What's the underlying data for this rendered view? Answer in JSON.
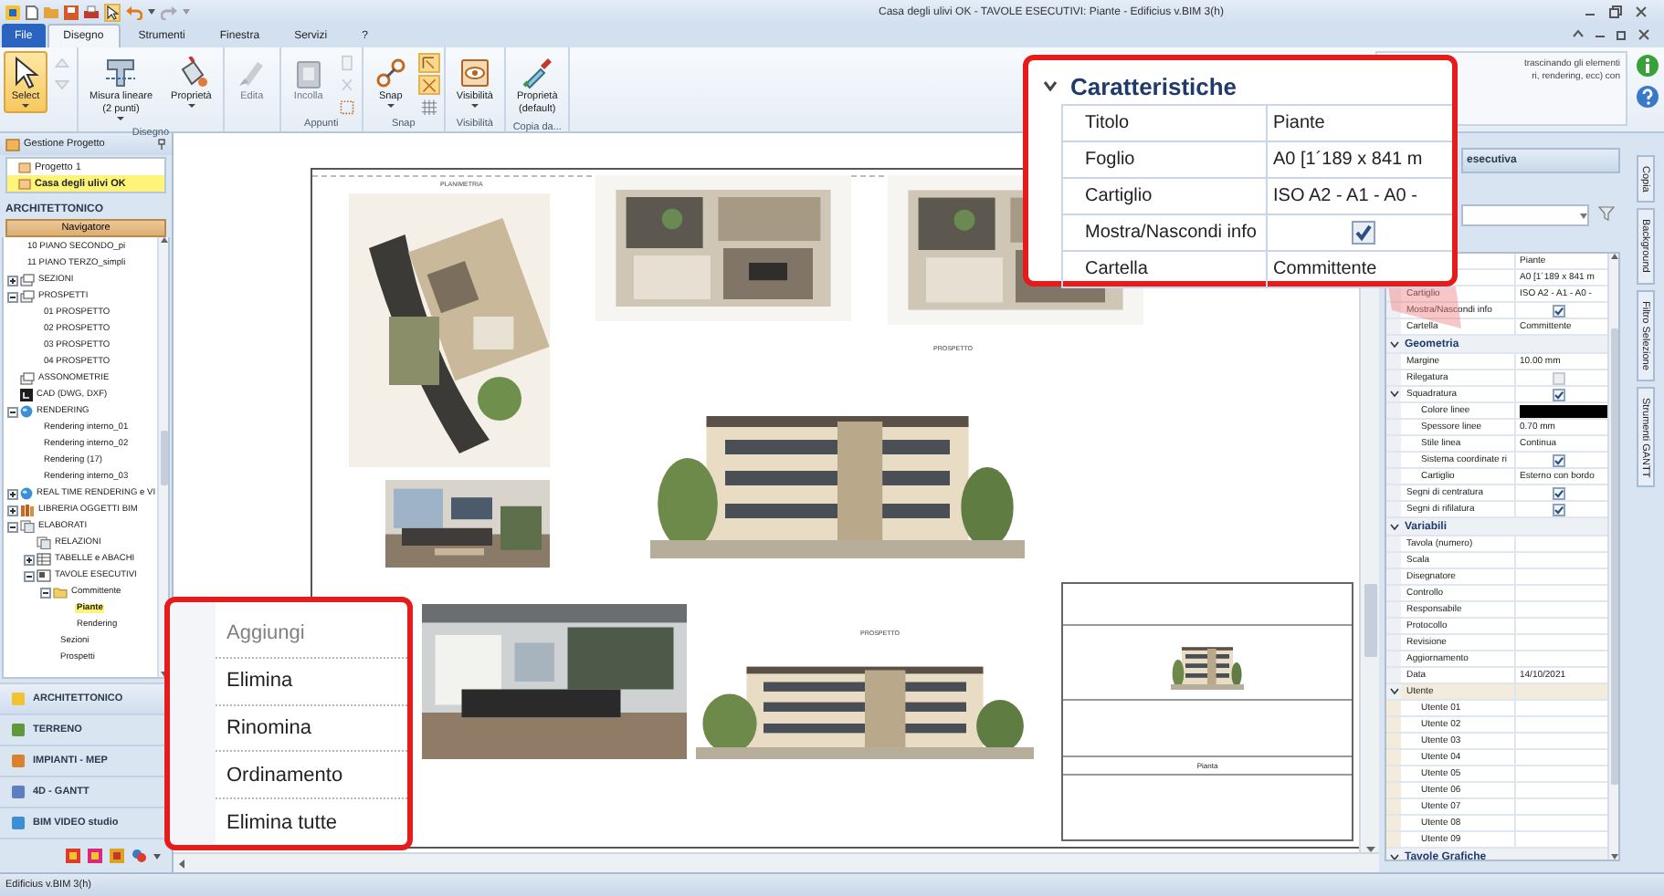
{
  "title_bar": {
    "title": "Casa degli ulivi OK -  TAVOLE ESECUTIVI: Piante - Edificius v.BIM 3(h)"
  },
  "menu_tabs": [
    {
      "label": "File",
      "kind": "file",
      "selected": false
    },
    {
      "label": "Disegno",
      "kind": "tab",
      "selected": true
    },
    {
      "label": "Strumenti",
      "kind": "tab",
      "selected": false
    },
    {
      "label": "Finestra",
      "kind": "tab",
      "selected": false
    },
    {
      "label": "Servizi",
      "kind": "tab",
      "selected": false
    },
    {
      "label": "?",
      "kind": "tab",
      "selected": false
    }
  ],
  "ribbon": {
    "groups": [
      {
        "items": [
          {
            "kind": "large",
            "lines": [
              "Select"
            ],
            "selected": true,
            "disabled": false,
            "dropdown": true
          },
          {
            "kind": "stack",
            "buttons": [
              {
                "selected": false,
                "disabled": true
              },
              {
                "selected": false,
                "disabled": true
              }
            ]
          }
        ]
      },
      {
        "label": "Disegno",
        "items": [
          {
            "kind": "large",
            "lines": [
              "Misura lineare",
              "(2 punti)"
            ],
            "selected": false,
            "disabled": false,
            "dropdown": true
          },
          {
            "kind": "large",
            "lines": [
              "Proprietà"
            ],
            "selected": false,
            "disabled": false,
            "dropdown": true
          }
        ]
      },
      {
        "items": [
          {
            "kind": "large",
            "lines": [
              "Edita"
            ],
            "selected": false,
            "disabled": true,
            "dropdown": false
          }
        ]
      },
      {
        "label": "Appunti",
        "items": [
          {
            "kind": "large",
            "lines": [
              "Incolla"
            ],
            "selected": false,
            "disabled": true,
            "dropdown": false
          },
          {
            "kind": "stack",
            "buttons": [
              {
                "selected": false,
                "disabled": true
              },
              {
                "selected": false,
                "disabled": true
              },
              {
                "selected": false,
                "disabled": false
              }
            ]
          }
        ]
      },
      {
        "label": "Snap",
        "items": [
          {
            "kind": "large",
            "lines": [
              "Snap"
            ],
            "selected": false,
            "disabled": false,
            "dropdown": true
          },
          {
            "kind": "stack",
            "buttons": [
              {
                "selected": true,
                "disabled": false
              },
              {
                "selected": true,
                "disabled": false
              },
              {
                "selected": false,
                "disabled": false
              }
            ]
          }
        ]
      },
      {
        "label": "Visibilità",
        "items": [
          {
            "kind": "large",
            "lines": [
              "Visibilità"
            ],
            "selected": false,
            "disabled": false,
            "dropdown": true
          }
        ]
      },
      {
        "label": "Copia da...",
        "items": [
          {
            "kind": "large",
            "lines": [
              "Proprietà",
              "(default)"
            ],
            "selected": false,
            "disabled": false,
            "dropdown": false
          }
        ]
      }
    ]
  },
  "help_hint": {
    "lines": [
      "trascinando gli elementi",
      "ri, rendering, ecc) con"
    ]
  },
  "project_panel": {
    "title": "Gestione Progetto",
    "projects": [
      {
        "label": "Progetto 1",
        "selected": false
      },
      {
        "label": "Casa degli ulivi OK",
        "selected": true
      }
    ]
  },
  "navigator": {
    "section": "ARCHITETTONICO",
    "button": "Navigatore",
    "tree": [
      {
        "label": "10 PIANO SECONDO_pi",
        "kind": "plain",
        "selected": false
      },
      {
        "label": "11 PIANO TERZO_simpli",
        "kind": "plain",
        "selected": false
      },
      {
        "label": "SEZIONI",
        "kind": "views",
        "selected": false,
        "expanded": false
      },
      {
        "label": "PROSPETTI",
        "kind": "views",
        "selected": false,
        "expanded": true,
        "children": [
          {
            "label": "01 PROSPETTO",
            "kind": "plain",
            "selected": false
          },
          {
            "label": "02 PROSPETTO",
            "kind": "plain",
            "selected": false
          },
          {
            "label": "03 PROSPETTO",
            "kind": "plain",
            "selected": false
          },
          {
            "label": "04 PROSPETTO",
            "kind": "plain",
            "selected": false
          }
        ]
      },
      {
        "label": "ASSONOMETRIE",
        "kind": "views",
        "selected": false
      },
      {
        "label": "CAD (DWG, DXF)",
        "kind": "cad",
        "selected": false
      },
      {
        "label": "RENDERING",
        "kind": "globe",
        "selected": false,
        "expanded": true,
        "children": [
          {
            "label": "Rendering interno_01",
            "kind": "plain",
            "selected": false
          },
          {
            "label": "Rendering interno_02",
            "kind": "plain",
            "selected": false
          },
          {
            "label": "Rendering (17)",
            "kind": "plain",
            "selected": false
          },
          {
            "label": "Rendering interno_03",
            "kind": "plain",
            "selected": false
          }
        ]
      },
      {
        "label": "REAL TIME RENDERING e VI",
        "kind": "globe",
        "selected": false,
        "expanded": false
      },
      {
        "label": "LIBRERIA OGGETTI BIM",
        "kind": "library",
        "selected": false,
        "expanded": false
      },
      {
        "label": "ELABORATI",
        "kind": "docs",
        "selected": false,
        "expanded": true,
        "children": [
          {
            "label": "RELAZIONI",
            "kind": "docs",
            "selected": false
          },
          {
            "label": "TABELLE e ABACHI",
            "kind": "table",
            "selected": false,
            "expanded": false
          },
          {
            "label": "TAVOLE ESECUTIVI",
            "kind": "sheet",
            "selected": false,
            "expanded": true,
            "children": [
              {
                "label": "Committente",
                "kind": "folder",
                "selected": false,
                "expanded": true,
                "children": [
                  {
                    "label": "Piante",
                    "kind": "plain",
                    "selected": true
                  },
                  {
                    "label": "Rendering",
                    "kind": "plain",
                    "selected": false
                  }
                ]
              },
              {
                "label": "Sezioni",
                "kind": "plain",
                "selected": false
              },
              {
                "label": "Prospetti",
                "kind": "plain",
                "selected": false
              }
            ]
          }
        ]
      }
    ]
  },
  "modules": [
    {
      "label": "ARCHITETTONICO",
      "selected": true
    },
    {
      "label": "TERRENO",
      "selected": false
    },
    {
      "label": "IMPIANTI - MEP",
      "selected": false
    },
    {
      "label": "4D - GANTT",
      "selected": false
    },
    {
      "label": "BIM VIDEO studio",
      "selected": false
    }
  ],
  "sheet": {
    "labels": [
      "PLANIMETRIA",
      "PROSPETTO",
      "PROSPETTO"
    ],
    "title_block": {
      "caption": "Pianta"
    }
  },
  "properties_panel": {
    "header": "esecutiva",
    "sections": [
      {
        "rows": [
          {
            "kind": "text",
            "value": "Piante"
          },
          {
            "kind": "text",
            "value": "A0 [1´189 x 841 m"
          },
          {
            "kind": "text",
            "name": "Cartiglio",
            "value": "ISO  A2 - A1 - A0 -"
          },
          {
            "kind": "check",
            "name": "Mostra/Nascondi info",
            "checked": true,
            "disabled": false
          },
          {
            "kind": "text",
            "name": "Cartella",
            "value": "Committente"
          }
        ]
      },
      {
        "title": "Geometria",
        "expanded": true,
        "rows": [
          {
            "kind": "text",
            "name": "Margine",
            "value": "10.00 mm"
          },
          {
            "kind": "check",
            "name": "Rilegatura",
            "checked": false,
            "disabled": true
          },
          {
            "kind": "check",
            "name": "Squadratura",
            "checked": true,
            "disabled": false,
            "expanded": true,
            "children": [
              {
                "kind": "color",
                "name": "Colore linee",
                "color": "#000000"
              },
              {
                "kind": "text",
                "name": "Spessore linee",
                "value": "0.70 mm"
              },
              {
                "kind": "text",
                "name": "Stile linea",
                "value": "Continua"
              },
              {
                "kind": "check",
                "name": "Sistema coordinate ri",
                "checked": true,
                "disabled": false
              },
              {
                "kind": "text",
                "name": "Cartiglio",
                "value": "Esterno con bordo"
              }
            ]
          },
          {
            "kind": "check",
            "name": "Segni di centratura",
            "checked": true,
            "disabled": false
          },
          {
            "kind": "check",
            "name": "Segni di rifilatura",
            "checked": true,
            "disabled": false
          }
        ]
      },
      {
        "title": "Variabili",
        "expanded": true,
        "rows": [
          {
            "kind": "text",
            "name": "Tavola (numero)"
          },
          {
            "kind": "text",
            "name": "Scala"
          },
          {
            "kind": "text",
            "name": "Disegnatore"
          },
          {
            "kind": "text",
            "name": "Controllo"
          },
          {
            "kind": "text",
            "name": "Responsabile"
          },
          {
            "kind": "text",
            "name": "Protocollo"
          },
          {
            "kind": "text",
            "name": "Revisione"
          },
          {
            "kind": "text",
            "name": "Aggiornamento"
          },
          {
            "kind": "text",
            "name": "Data",
            "value": "14/10/2021"
          },
          {
            "kind": "group",
            "name": "Utente",
            "expanded": true,
            "children": [
              {
                "kind": "text",
                "name": "Utente 01"
              },
              {
                "kind": "text",
                "name": "Utente 02"
              },
              {
                "kind": "text",
                "name": "Utente 03"
              },
              {
                "kind": "text",
                "name": "Utente 04"
              },
              {
                "kind": "text",
                "name": "Utente 05"
              },
              {
                "kind": "text",
                "name": "Utente 06"
              },
              {
                "kind": "text",
                "name": "Utente 07"
              },
              {
                "kind": "text",
                "name": "Utente 08"
              },
              {
                "kind": "text",
                "name": "Utente 09"
              }
            ]
          }
        ]
      },
      {
        "title": "Tavole Grafiche",
        "expanded": true
      }
    ]
  },
  "side_tabs": [
    {
      "label": "Copia"
    },
    {
      "label": "Background"
    },
    {
      "label": "Filtro Selezione"
    },
    {
      "label": "Strumenti GANTT"
    }
  ],
  "properties_callout": {
    "title": "Caratteristiche",
    "expanded": true,
    "rows": [
      {
        "kind": "text",
        "name": "Titolo",
        "value": "Piante"
      },
      {
        "kind": "text",
        "name": "Foglio",
        "value": "A0 [1´189 x 841 m"
      },
      {
        "kind": "text",
        "name": "Cartiglio",
        "value": "ISO  A2 - A1 - A0 -"
      },
      {
        "kind": "check",
        "name": "Mostra/Nascondi info",
        "checked": true
      },
      {
        "kind": "text",
        "name": "Cartella",
        "value": "Committente"
      }
    ]
  },
  "context_menu": {
    "items": [
      {
        "label": "Aggiungi",
        "disabled": true
      },
      {
        "label": "Elimina",
        "disabled": false
      },
      {
        "label": "Rinomina",
        "disabled": false
      },
      {
        "label": "Ordinamento",
        "disabled": false
      },
      {
        "label": "Elimina tutte",
        "disabled": false
      }
    ]
  },
  "status_bar": {
    "text": "Edificius v.BIM 3(h)"
  }
}
